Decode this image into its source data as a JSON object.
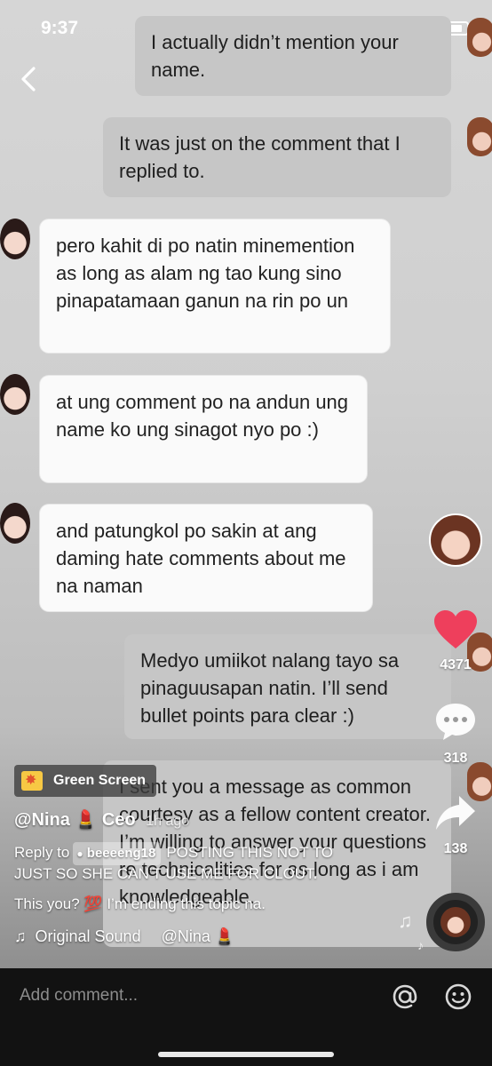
{
  "status_bar": {
    "time": "9:37"
  },
  "messages": [
    {
      "sender": "me",
      "text": "I actually didn’t mention your name."
    },
    {
      "sender": "me",
      "text": "It was just on the comment that I replied to."
    },
    {
      "sender": "them",
      "text": "pero kahit di po natin minemention as long as alam ng tao kung sino pinapatamaan ganun na rin po un"
    },
    {
      "sender": "them",
      "text": "at ung comment po na andun ung name ko ung sinagot nyo po :)"
    },
    {
      "sender": "them",
      "text": "and patungkol po sakin at ang daming hate comments about me na naman"
    },
    {
      "sender": "me",
      "text": "Medyo umiikot nalang tayo sa pinaguusapan natin. I’ll send bullet points para clear :)"
    },
    {
      "sender": "me",
      "text": "I sent you a message as common courtesy as a fellow content creator. I’m willing to answer your questions re technicalities for as long as i am knowledgeable."
    }
  ],
  "actions": {
    "likes": "4371",
    "comments": "318",
    "shares": "138"
  },
  "video": {
    "effect_label": "Green Screen",
    "author": "@Nina 💄 Ceo",
    "time_ago": "1h ago",
    "reply_prefix": "Reply to",
    "reply_user": "beeeeng18",
    "caption_line1": "POSTING THIS NOT TO",
    "caption_line2": "JUST SO SHE CAN’T USE ME FOR CLOUT.",
    "caption_line3": "This you? 💯  I’m ending this topic na.",
    "sound_title": "Original Sound",
    "sound_author": "@Nina 💄"
  },
  "comment_bar": {
    "placeholder": "Add comment..."
  },
  "colors": {
    "like": "#ee3f5c",
    "comment_bar_bg": "#121212"
  }
}
